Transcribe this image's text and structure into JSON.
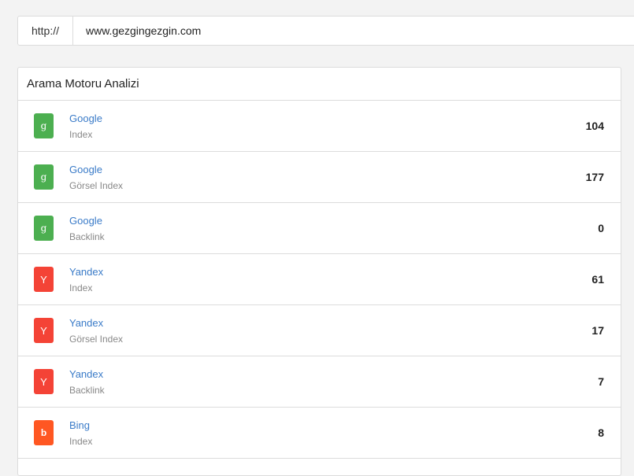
{
  "url_bar": {
    "prefix": "http://",
    "value": "www.gezgingezgin.com"
  },
  "panel": {
    "title": "Arama Motoru Analizi"
  },
  "colors": {
    "google": "#4caf50",
    "yandex": "#f44336",
    "bing": "#ff5722",
    "link": "#3a7bc8"
  },
  "rows": [
    {
      "letter": "g",
      "icon": "google-icon",
      "engine": "Google",
      "type": "Index",
      "count": "104"
    },
    {
      "letter": "g",
      "icon": "google-icon",
      "engine": "Google",
      "type": "Görsel Index",
      "count": "177"
    },
    {
      "letter": "g",
      "icon": "google-icon",
      "engine": "Google",
      "type": "Backlink",
      "count": "0"
    },
    {
      "letter": "Y",
      "icon": "yandex-icon",
      "engine": "Yandex",
      "type": "Index",
      "count": "61"
    },
    {
      "letter": "Y",
      "icon": "yandex-icon",
      "engine": "Yandex",
      "type": "Görsel Index",
      "count": "17"
    },
    {
      "letter": "Y",
      "icon": "yandex-icon",
      "engine": "Yandex",
      "type": "Backlink",
      "count": "7"
    },
    {
      "letter": "b",
      "icon": "bing-icon",
      "engine": "Bing",
      "type": "Index",
      "count": "8"
    }
  ]
}
